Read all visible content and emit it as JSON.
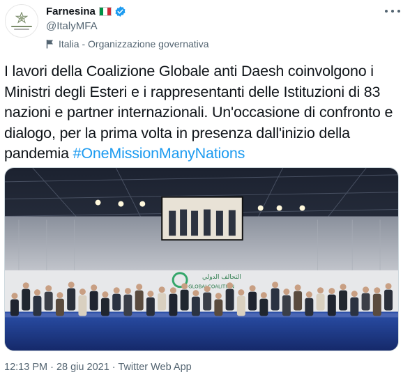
{
  "author": {
    "display_name": "Farnesina",
    "handle": "@ItalyMFA",
    "account_label": "Italia - Organizzazione governativa",
    "flag_colors": [
      "#009246",
      "#ffffff",
      "#ce2b37"
    ],
    "verified_color": "#1d9bf0",
    "avatar_icon": "italian-emblem-icon"
  },
  "tweet": {
    "text_before": "I lavori della Coalizione Globale anti Daesh coinvolgono i Ministri degli Esteri e i rappresentanti delle Istituzioni di 83 nazioni e partner internazionali. Un'occasione di confronto e dialogo, per la prima volta in presenza dall'inizio della pandemia ",
    "hashtag": "#OneMissionManyNations",
    "hashtag_color": "#1d9bf0"
  },
  "media": {
    "banner_arabic": "التحالف الدولي",
    "banner_latin": "GLOBALCOALITION"
  },
  "footer": {
    "time": "12:13 PM",
    "separator": " · ",
    "date": "28 giu 2021",
    "source": "Twitter Web App"
  }
}
